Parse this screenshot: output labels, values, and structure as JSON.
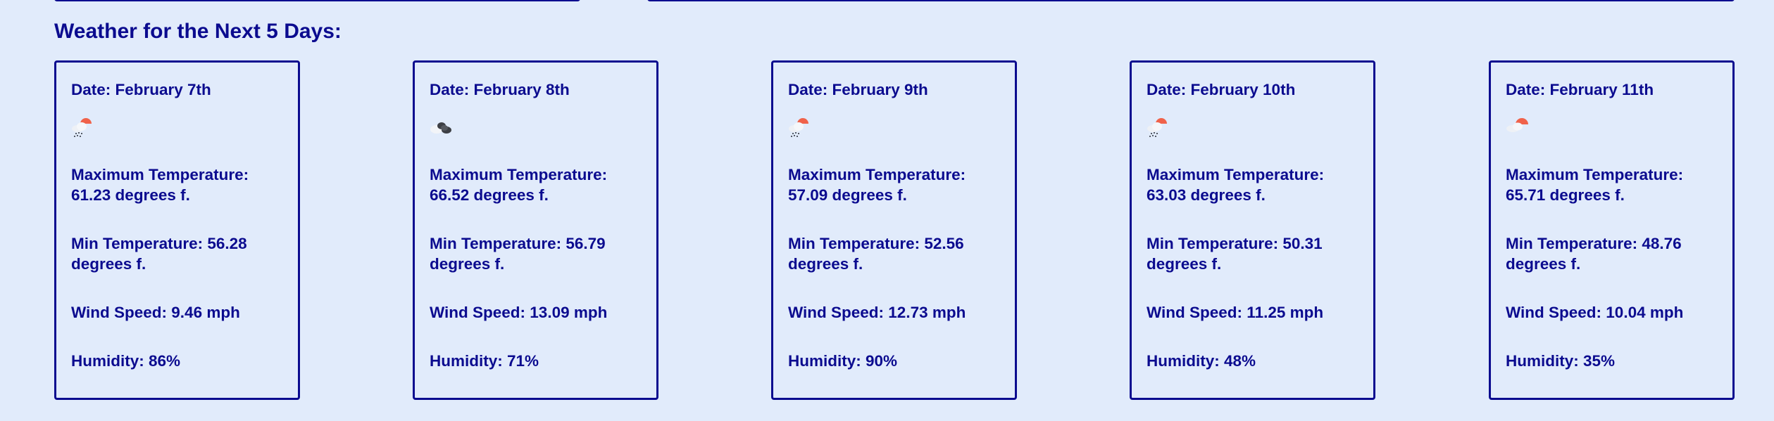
{
  "section": {
    "title": "Weather for the Next 5 Days:"
  },
  "forecast": [
    {
      "date": "Date: February 7th",
      "icon": "light-rain-sun-icon",
      "max_temp": "Maximum Temperature: 61.23 degrees f.",
      "min_temp": "Min Temperature: 56.28 degrees f.",
      "wind": "Wind Speed: 9.46 mph",
      "humidity": "Humidity: 86%"
    },
    {
      "date": "Date: February 8th",
      "icon": "broken-clouds-icon",
      "max_temp": "Maximum Temperature: 66.52 degrees f.",
      "min_temp": "Min Temperature: 56.79 degrees f.",
      "wind": "Wind Speed: 13.09 mph",
      "humidity": "Humidity: 71%"
    },
    {
      "date": "Date: February 9th",
      "icon": "light-rain-sun-icon",
      "max_temp": "Maximum Temperature: 57.09 degrees f.",
      "min_temp": "Min Temperature: 52.56 degrees f.",
      "wind": "Wind Speed: 12.73 mph",
      "humidity": "Humidity: 90%"
    },
    {
      "date": "Date: February 10th",
      "icon": "light-rain-sun-icon",
      "max_temp": "Maximum Temperature: 63.03 degrees f.",
      "min_temp": "Min Temperature: 50.31 degrees f.",
      "wind": "Wind Speed: 11.25 mph",
      "humidity": "Humidity: 48%"
    },
    {
      "date": "Date: February 11th",
      "icon": "partly-cloudy-sun-icon",
      "max_temp": "Maximum Temperature: 65.71 degrees f.",
      "min_temp": "Min Temperature: 48.76 degrees f.",
      "wind": "Wind Speed: 10.04 mph",
      "humidity": "Humidity: 35%"
    }
  ],
  "colors": {
    "background": "#e1ebfb",
    "text": "#0b0b8f",
    "border": "#0b0b8f",
    "sun": "#f0624a"
  }
}
